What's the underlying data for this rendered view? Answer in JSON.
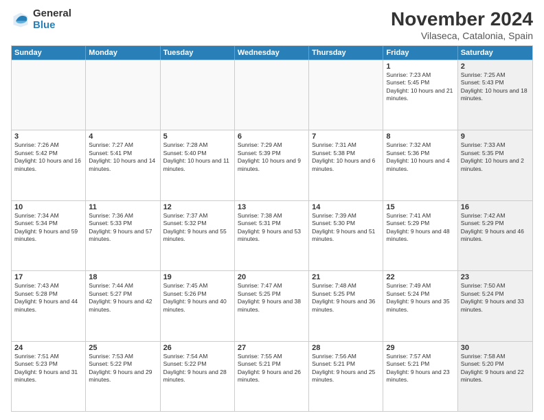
{
  "logo": {
    "general": "General",
    "blue": "Blue"
  },
  "title": "November 2024",
  "location": "Vilaseca, Catalonia, Spain",
  "header_days": [
    "Sunday",
    "Monday",
    "Tuesday",
    "Wednesday",
    "Thursday",
    "Friday",
    "Saturday"
  ],
  "weeks": [
    [
      {
        "day": "",
        "info": "",
        "shaded": false,
        "empty": true
      },
      {
        "day": "",
        "info": "",
        "shaded": false,
        "empty": true
      },
      {
        "day": "",
        "info": "",
        "shaded": false,
        "empty": true
      },
      {
        "day": "",
        "info": "",
        "shaded": false,
        "empty": true
      },
      {
        "day": "",
        "info": "",
        "shaded": false,
        "empty": true
      },
      {
        "day": "1",
        "info": "Sunrise: 7:23 AM\nSunset: 5:45 PM\nDaylight: 10 hours and 21 minutes.",
        "shaded": false,
        "empty": false
      },
      {
        "day": "2",
        "info": "Sunrise: 7:25 AM\nSunset: 5:43 PM\nDaylight: 10 hours and 18 minutes.",
        "shaded": true,
        "empty": false
      }
    ],
    [
      {
        "day": "3",
        "info": "Sunrise: 7:26 AM\nSunset: 5:42 PM\nDaylight: 10 hours and 16 minutes.",
        "shaded": false,
        "empty": false
      },
      {
        "day": "4",
        "info": "Sunrise: 7:27 AM\nSunset: 5:41 PM\nDaylight: 10 hours and 14 minutes.",
        "shaded": false,
        "empty": false
      },
      {
        "day": "5",
        "info": "Sunrise: 7:28 AM\nSunset: 5:40 PM\nDaylight: 10 hours and 11 minutes.",
        "shaded": false,
        "empty": false
      },
      {
        "day": "6",
        "info": "Sunrise: 7:29 AM\nSunset: 5:39 PM\nDaylight: 10 hours and 9 minutes.",
        "shaded": false,
        "empty": false
      },
      {
        "day": "7",
        "info": "Sunrise: 7:31 AM\nSunset: 5:38 PM\nDaylight: 10 hours and 6 minutes.",
        "shaded": false,
        "empty": false
      },
      {
        "day": "8",
        "info": "Sunrise: 7:32 AM\nSunset: 5:36 PM\nDaylight: 10 hours and 4 minutes.",
        "shaded": false,
        "empty": false
      },
      {
        "day": "9",
        "info": "Sunrise: 7:33 AM\nSunset: 5:35 PM\nDaylight: 10 hours and 2 minutes.",
        "shaded": true,
        "empty": false
      }
    ],
    [
      {
        "day": "10",
        "info": "Sunrise: 7:34 AM\nSunset: 5:34 PM\nDaylight: 9 hours and 59 minutes.",
        "shaded": false,
        "empty": false
      },
      {
        "day": "11",
        "info": "Sunrise: 7:36 AM\nSunset: 5:33 PM\nDaylight: 9 hours and 57 minutes.",
        "shaded": false,
        "empty": false
      },
      {
        "day": "12",
        "info": "Sunrise: 7:37 AM\nSunset: 5:32 PM\nDaylight: 9 hours and 55 minutes.",
        "shaded": false,
        "empty": false
      },
      {
        "day": "13",
        "info": "Sunrise: 7:38 AM\nSunset: 5:31 PM\nDaylight: 9 hours and 53 minutes.",
        "shaded": false,
        "empty": false
      },
      {
        "day": "14",
        "info": "Sunrise: 7:39 AM\nSunset: 5:30 PM\nDaylight: 9 hours and 51 minutes.",
        "shaded": false,
        "empty": false
      },
      {
        "day": "15",
        "info": "Sunrise: 7:41 AM\nSunset: 5:29 PM\nDaylight: 9 hours and 48 minutes.",
        "shaded": false,
        "empty": false
      },
      {
        "day": "16",
        "info": "Sunrise: 7:42 AM\nSunset: 5:29 PM\nDaylight: 9 hours and 46 minutes.",
        "shaded": true,
        "empty": false
      }
    ],
    [
      {
        "day": "17",
        "info": "Sunrise: 7:43 AM\nSunset: 5:28 PM\nDaylight: 9 hours and 44 minutes.",
        "shaded": false,
        "empty": false
      },
      {
        "day": "18",
        "info": "Sunrise: 7:44 AM\nSunset: 5:27 PM\nDaylight: 9 hours and 42 minutes.",
        "shaded": false,
        "empty": false
      },
      {
        "day": "19",
        "info": "Sunrise: 7:45 AM\nSunset: 5:26 PM\nDaylight: 9 hours and 40 minutes.",
        "shaded": false,
        "empty": false
      },
      {
        "day": "20",
        "info": "Sunrise: 7:47 AM\nSunset: 5:25 PM\nDaylight: 9 hours and 38 minutes.",
        "shaded": false,
        "empty": false
      },
      {
        "day": "21",
        "info": "Sunrise: 7:48 AM\nSunset: 5:25 PM\nDaylight: 9 hours and 36 minutes.",
        "shaded": false,
        "empty": false
      },
      {
        "day": "22",
        "info": "Sunrise: 7:49 AM\nSunset: 5:24 PM\nDaylight: 9 hours and 35 minutes.",
        "shaded": false,
        "empty": false
      },
      {
        "day": "23",
        "info": "Sunrise: 7:50 AM\nSunset: 5:24 PM\nDaylight: 9 hours and 33 minutes.",
        "shaded": true,
        "empty": false
      }
    ],
    [
      {
        "day": "24",
        "info": "Sunrise: 7:51 AM\nSunset: 5:23 PM\nDaylight: 9 hours and 31 minutes.",
        "shaded": false,
        "empty": false
      },
      {
        "day": "25",
        "info": "Sunrise: 7:53 AM\nSunset: 5:22 PM\nDaylight: 9 hours and 29 minutes.",
        "shaded": false,
        "empty": false
      },
      {
        "day": "26",
        "info": "Sunrise: 7:54 AM\nSunset: 5:22 PM\nDaylight: 9 hours and 28 minutes.",
        "shaded": false,
        "empty": false
      },
      {
        "day": "27",
        "info": "Sunrise: 7:55 AM\nSunset: 5:21 PM\nDaylight: 9 hours and 26 minutes.",
        "shaded": false,
        "empty": false
      },
      {
        "day": "28",
        "info": "Sunrise: 7:56 AM\nSunset: 5:21 PM\nDaylight: 9 hours and 25 minutes.",
        "shaded": false,
        "empty": false
      },
      {
        "day": "29",
        "info": "Sunrise: 7:57 AM\nSunset: 5:21 PM\nDaylight: 9 hours and 23 minutes.",
        "shaded": false,
        "empty": false
      },
      {
        "day": "30",
        "info": "Sunrise: 7:58 AM\nSunset: 5:20 PM\nDaylight: 9 hours and 22 minutes.",
        "shaded": true,
        "empty": false
      }
    ]
  ]
}
